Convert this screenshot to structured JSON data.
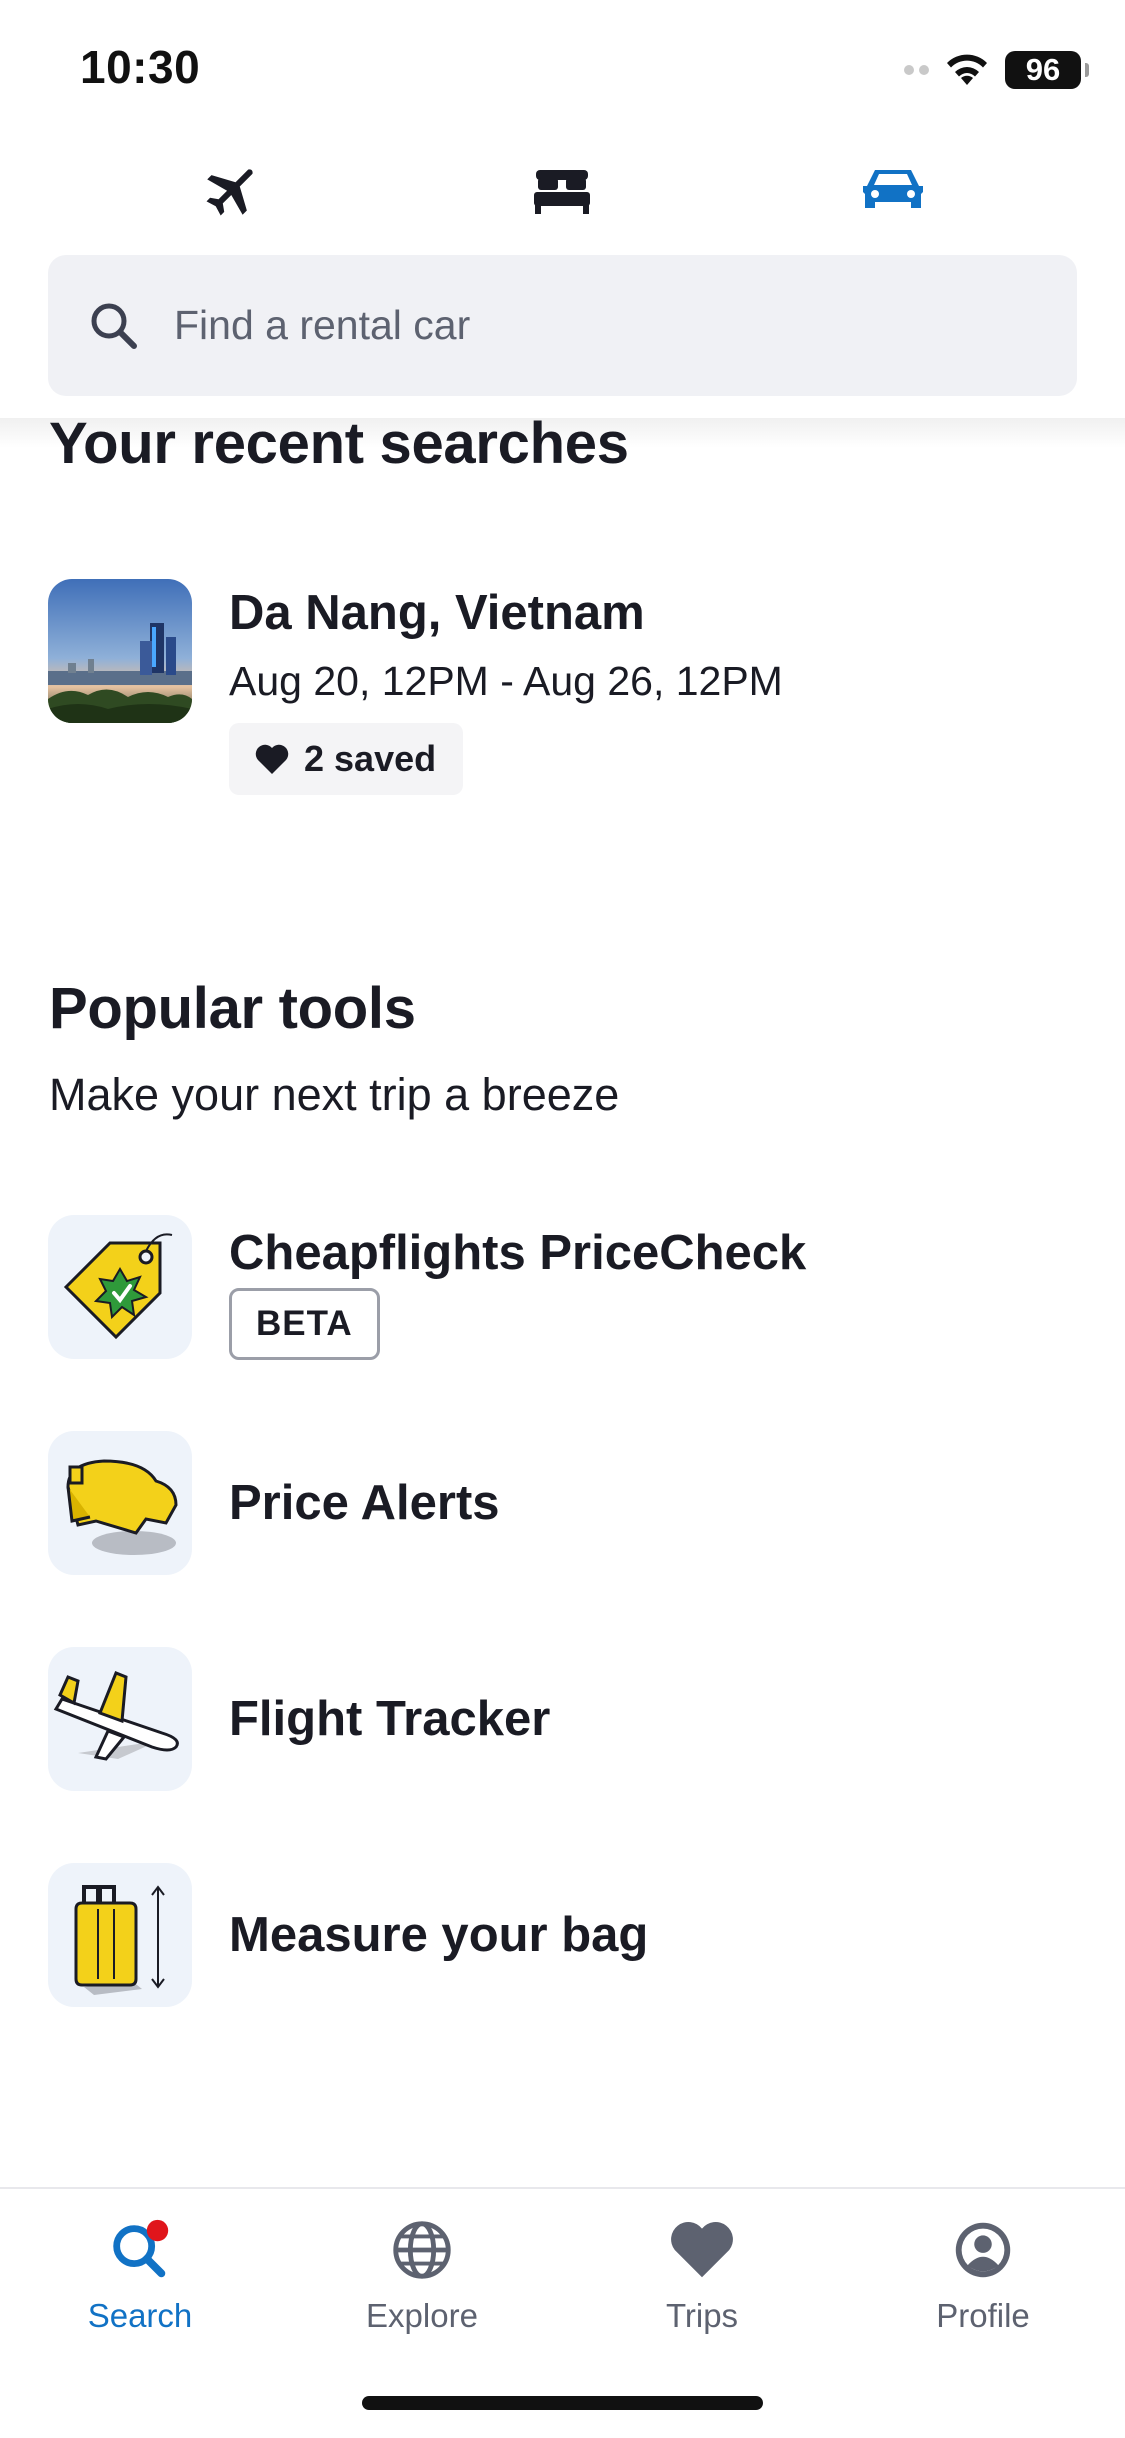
{
  "status_bar": {
    "time": "10:30",
    "battery": "96"
  },
  "mode_tabs": [
    {
      "name": "flights",
      "icon": "airplane-icon",
      "active": false
    },
    {
      "name": "stays",
      "icon": "bed-icon",
      "active": false
    },
    {
      "name": "cars",
      "icon": "car-icon",
      "active": true
    }
  ],
  "search": {
    "placeholder": "Find a rental car"
  },
  "recent": {
    "title": "Your recent searches",
    "items": [
      {
        "place": "Da Nang, Vietnam",
        "dates": "Aug 20, 12PM - Aug 26, 12PM",
        "saved": "2 saved"
      }
    ]
  },
  "tools": {
    "title": "Popular tools",
    "subtitle": "Make your next trip a breeze",
    "items": [
      {
        "label": "Cheapflights PriceCheck",
        "badge": "BETA",
        "icon": "price-tag-icon"
      },
      {
        "label": "Price Alerts",
        "icon": "bell-icon"
      },
      {
        "label": "Flight Tracker",
        "icon": "airplane-icon"
      },
      {
        "label": "Measure your bag",
        "icon": "suitcase-icon"
      }
    ]
  },
  "bottom_nav": [
    {
      "label": "Search",
      "icon": "search-icon",
      "active": true
    },
    {
      "label": "Explore",
      "icon": "globe-icon",
      "active": false
    },
    {
      "label": "Trips",
      "icon": "heart-icon",
      "active": false
    },
    {
      "label": "Profile",
      "icon": "profile-icon",
      "active": false
    }
  ],
  "colors": {
    "accent": "#1172c5",
    "text": "#1a1b24",
    "muted": "#5d6270",
    "search_bg": "#f0f1f5",
    "notification_dot": "#e0151b",
    "tool_yellow": "#f3d11a"
  }
}
